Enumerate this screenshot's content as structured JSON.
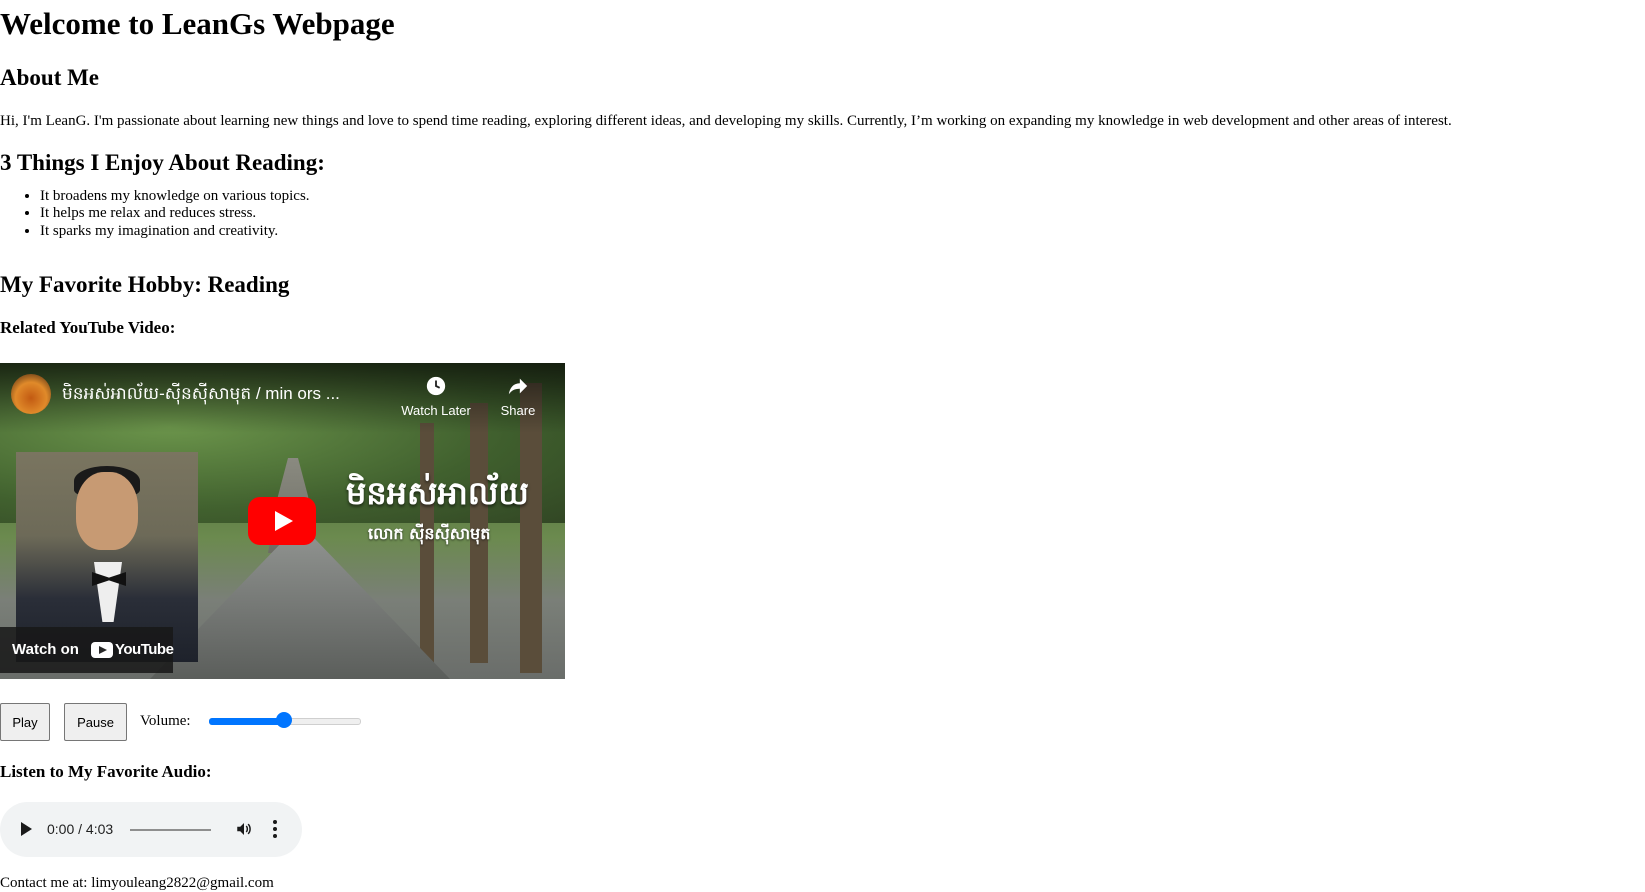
{
  "page": {
    "title": "Welcome to LeanGs Webpage",
    "about_heading": "About Me",
    "about_text": "Hi, I'm LeanG. I'm passionate about learning new things and love to spend time reading, exploring different ideas, and developing my skills. Currently, I’m working on expanding my knowledge in web development and other areas of interest.",
    "reading_heading": "3 Things I Enjoy About Reading:",
    "reading_items": [
      "It broadens my knowledge on various topics.",
      "It helps me relax and reduces stress.",
      "It sparks my imagination and creativity."
    ],
    "hobby_heading": "My Favorite Hobby: Reading",
    "video_heading": "Related YouTube Video:",
    "audio_heading": "Listen to My Favorite Audio:",
    "contact_text": "Contact me at: limyouleang2822@gmail.com"
  },
  "video": {
    "title": "មិនអស់អាល័យ-ស៊ីនស៊ីសាមុត / min ors ...",
    "overlay_title": "មិនអស់អាល័យ",
    "overlay_subtitle": "លោក  ស៊ីនស៊ីសាមុត",
    "watch_later_label": "Watch Later",
    "share_label": "Share",
    "watch_on_label": "Watch on",
    "youtube_label": "YouTube"
  },
  "controls": {
    "play_label": "Play",
    "pause_label": "Pause",
    "volume_label": "Volume:",
    "volume_value": 0.5
  },
  "audio": {
    "time": "0:00 / 4:03"
  },
  "colors": {
    "slider_accent": "#0075ff",
    "youtube_red": "#ff0000"
  }
}
